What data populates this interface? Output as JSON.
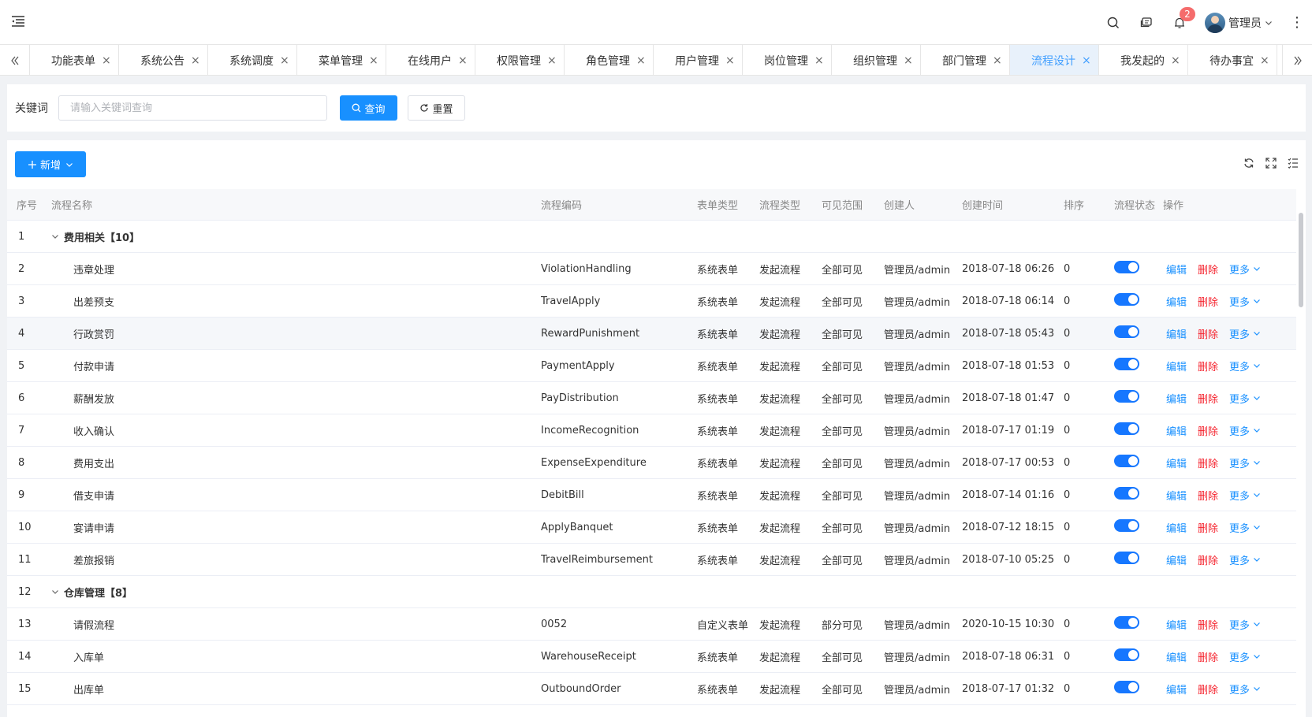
{
  "header": {
    "notification_count": "2",
    "user_name": "管理员"
  },
  "tabs": [
    {
      "label": "功能表单",
      "active": false
    },
    {
      "label": "系统公告",
      "active": false
    },
    {
      "label": "系统调度",
      "active": false
    },
    {
      "label": "菜单管理",
      "active": false
    },
    {
      "label": "在线用户",
      "active": false
    },
    {
      "label": "权限管理",
      "active": false
    },
    {
      "label": "角色管理",
      "active": false
    },
    {
      "label": "用户管理",
      "active": false
    },
    {
      "label": "岗位管理",
      "active": false
    },
    {
      "label": "组织管理",
      "active": false
    },
    {
      "label": "部门管理",
      "active": false
    },
    {
      "label": "流程设计",
      "active": true
    },
    {
      "label": "我发起的",
      "active": false
    },
    {
      "label": "待办事宜",
      "active": false
    }
  ],
  "search": {
    "label": "关键词",
    "placeholder": "请输入关键词查询",
    "query_label": "查询",
    "reset_label": "重置"
  },
  "toolbar": {
    "add_label": "新增"
  },
  "table": {
    "columns": {
      "idx": "序号",
      "name": "流程名称",
      "code": "流程编码",
      "form": "表单类型",
      "ptype": "流程类型",
      "scope": "可见范围",
      "creator": "创建人",
      "time": "创建时间",
      "sort": "排序",
      "status": "流程状态",
      "ops": "操作"
    },
    "ops": {
      "edit": "编辑",
      "delete": "删除",
      "more": "更多"
    },
    "rows": [
      {
        "idx": "1",
        "group": true,
        "name": "费用相关【10】"
      },
      {
        "idx": "2",
        "name": "违章处理",
        "code": "ViolationHandling",
        "form": "系统表单",
        "ptype": "发起流程",
        "scope": "全部可见",
        "creator": "管理员/admin",
        "time": "2018-07-18 06:26",
        "sort": "0"
      },
      {
        "idx": "3",
        "name": "出差预支",
        "code": "TravelApply",
        "form": "系统表单",
        "ptype": "发起流程",
        "scope": "全部可见",
        "creator": "管理员/admin",
        "time": "2018-07-18 06:14",
        "sort": "0"
      },
      {
        "idx": "4",
        "name": "行政赏罚",
        "code": "RewardPunishment",
        "form": "系统表单",
        "ptype": "发起流程",
        "scope": "全部可见",
        "creator": "管理员/admin",
        "time": "2018-07-18 05:43",
        "sort": "0",
        "highlight": true
      },
      {
        "idx": "5",
        "name": "付款申请",
        "code": "PaymentApply",
        "form": "系统表单",
        "ptype": "发起流程",
        "scope": "全部可见",
        "creator": "管理员/admin",
        "time": "2018-07-18 01:53",
        "sort": "0"
      },
      {
        "idx": "6",
        "name": "薪酬发放",
        "code": "PayDistribution",
        "form": "系统表单",
        "ptype": "发起流程",
        "scope": "全部可见",
        "creator": "管理员/admin",
        "time": "2018-07-18 01:47",
        "sort": "0"
      },
      {
        "idx": "7",
        "name": "收入确认",
        "code": "IncomeRecognition",
        "form": "系统表单",
        "ptype": "发起流程",
        "scope": "全部可见",
        "creator": "管理员/admin",
        "time": "2018-07-17 01:19",
        "sort": "0"
      },
      {
        "idx": "8",
        "name": "费用支出",
        "code": "ExpenseExpenditure",
        "form": "系统表单",
        "ptype": "发起流程",
        "scope": "全部可见",
        "creator": "管理员/admin",
        "time": "2018-07-17 00:53",
        "sort": "0"
      },
      {
        "idx": "9",
        "name": "借支申请",
        "code": "DebitBill",
        "form": "系统表单",
        "ptype": "发起流程",
        "scope": "全部可见",
        "creator": "管理员/admin",
        "time": "2018-07-14 01:16",
        "sort": "0"
      },
      {
        "idx": "10",
        "name": "宴请申请",
        "code": "ApplyBanquet",
        "form": "系统表单",
        "ptype": "发起流程",
        "scope": "全部可见",
        "creator": "管理员/admin",
        "time": "2018-07-12 18:15",
        "sort": "0"
      },
      {
        "idx": "11",
        "name": "差旅报销",
        "code": "TravelReimbursement",
        "form": "系统表单",
        "ptype": "发起流程",
        "scope": "全部可见",
        "creator": "管理员/admin",
        "time": "2018-07-10 05:25",
        "sort": "0"
      },
      {
        "idx": "12",
        "group": true,
        "name": "仓库管理【8】"
      },
      {
        "idx": "13",
        "name": "请假流程",
        "code": "0052",
        "form": "自定义表单",
        "ptype": "发起流程",
        "scope": "部分可见",
        "creator": "管理员/admin",
        "time": "2020-10-15 10:30",
        "sort": "0"
      },
      {
        "idx": "14",
        "name": "入库单",
        "code": "WarehouseReceipt",
        "form": "系统表单",
        "ptype": "发起流程",
        "scope": "全部可见",
        "creator": "管理员/admin",
        "time": "2018-07-18 06:31",
        "sort": "0"
      },
      {
        "idx": "15",
        "name": "出库单",
        "code": "OutboundOrder",
        "form": "系统表单",
        "ptype": "发起流程",
        "scope": "全部可见",
        "creator": "管理员/admin",
        "time": "2018-07-17 01:32",
        "sort": "0"
      }
    ]
  }
}
